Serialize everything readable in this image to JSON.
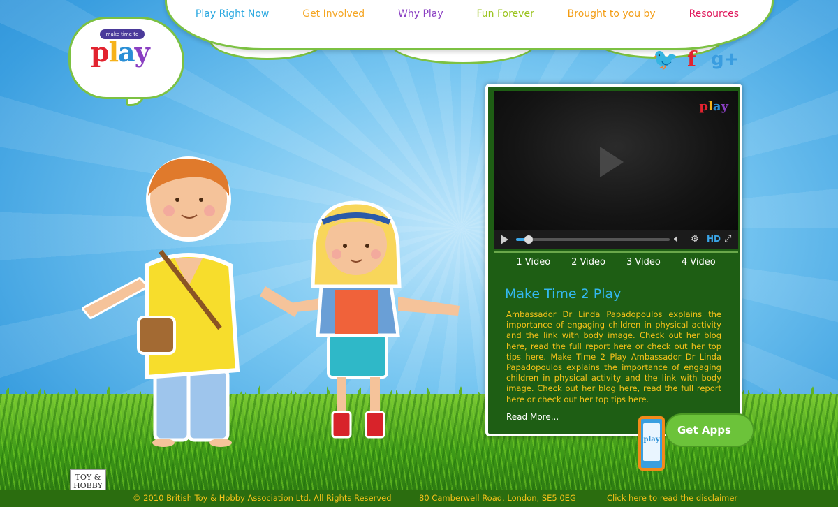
{
  "nav": {
    "items": [
      {
        "label": "Play Right Now",
        "color": "#2aa8e0"
      },
      {
        "label": "Get Involved",
        "color": "#f5a623"
      },
      {
        "label": "Why Play",
        "color": "#8a3fc2"
      },
      {
        "label": "Fun Forever",
        "color": "#9ac31c"
      },
      {
        "label": "Brought to you by",
        "color": "#f39c12"
      },
      {
        "label": "Resources",
        "color": "#e0185c"
      }
    ]
  },
  "logo": {
    "tagline": "make time to",
    "word": "play"
  },
  "social": [
    {
      "icon": "twitter-icon",
      "glyph": "🐦",
      "color": "#f6b21b"
    },
    {
      "icon": "facebook-icon",
      "glyph": "f",
      "color": "#e2232f"
    },
    {
      "icon": "google-plus-icon",
      "glyph": "g+",
      "color": "#3a9de0"
    }
  ],
  "player": {
    "logo_word": "play",
    "progress": 0.08,
    "hd_label": "HD"
  },
  "video_tabs": [
    "1 Video",
    "2 Video",
    "3 Video",
    "4 Video"
  ],
  "article": {
    "title": "Make Time 2 Play",
    "body": "Ambassador Dr Linda Papadopoulos explains the importance of engaging children in physical activity and the link with body image.  Check out her blog here, read the full report here or check out her top tips here. Make Time 2 Play Ambassador Dr Linda Papadopoulos explains the importance of engaging children in physical activity and the link with body image.  Check out her blog here, read the full report here or check out her top tips here.",
    "read_more": "Read More..."
  },
  "apps": {
    "label": "Get Apps",
    "phone_logo": "play"
  },
  "badge": {
    "line1": "TOY &",
    "line2": "HOBBY"
  },
  "footer": {
    "copyright": "© 2010 British Toy & Hobby Association Ltd. All Rights Reserved",
    "address": "80 Camberwell Road, London, SE5 0EG",
    "disclaimer": "Click here to read the disclaimer"
  }
}
